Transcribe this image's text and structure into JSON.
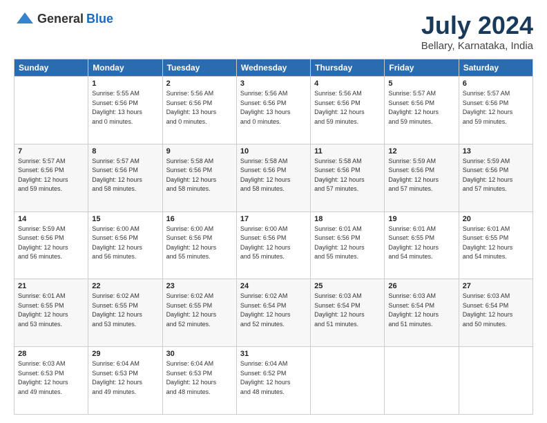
{
  "header": {
    "logo_general": "General",
    "logo_blue": "Blue",
    "month": "July 2024",
    "location": "Bellary, Karnataka, India"
  },
  "weekdays": [
    "Sunday",
    "Monday",
    "Tuesday",
    "Wednesday",
    "Thursday",
    "Friday",
    "Saturday"
  ],
  "weeks": [
    [
      {
        "day": "",
        "info": ""
      },
      {
        "day": "1",
        "info": "Sunrise: 5:55 AM\nSunset: 6:56 PM\nDaylight: 13 hours\nand 0 minutes."
      },
      {
        "day": "2",
        "info": "Sunrise: 5:56 AM\nSunset: 6:56 PM\nDaylight: 13 hours\nand 0 minutes."
      },
      {
        "day": "3",
        "info": "Sunrise: 5:56 AM\nSunset: 6:56 PM\nDaylight: 13 hours\nand 0 minutes."
      },
      {
        "day": "4",
        "info": "Sunrise: 5:56 AM\nSunset: 6:56 PM\nDaylight: 12 hours\nand 59 minutes."
      },
      {
        "day": "5",
        "info": "Sunrise: 5:57 AM\nSunset: 6:56 PM\nDaylight: 12 hours\nand 59 minutes."
      },
      {
        "day": "6",
        "info": "Sunrise: 5:57 AM\nSunset: 6:56 PM\nDaylight: 12 hours\nand 59 minutes."
      }
    ],
    [
      {
        "day": "7",
        "info": "Sunrise: 5:57 AM\nSunset: 6:56 PM\nDaylight: 12 hours\nand 59 minutes."
      },
      {
        "day": "8",
        "info": "Sunrise: 5:57 AM\nSunset: 6:56 PM\nDaylight: 12 hours\nand 58 minutes."
      },
      {
        "day": "9",
        "info": "Sunrise: 5:58 AM\nSunset: 6:56 PM\nDaylight: 12 hours\nand 58 minutes."
      },
      {
        "day": "10",
        "info": "Sunrise: 5:58 AM\nSunset: 6:56 PM\nDaylight: 12 hours\nand 58 minutes."
      },
      {
        "day": "11",
        "info": "Sunrise: 5:58 AM\nSunset: 6:56 PM\nDaylight: 12 hours\nand 57 minutes."
      },
      {
        "day": "12",
        "info": "Sunrise: 5:59 AM\nSunset: 6:56 PM\nDaylight: 12 hours\nand 57 minutes."
      },
      {
        "day": "13",
        "info": "Sunrise: 5:59 AM\nSunset: 6:56 PM\nDaylight: 12 hours\nand 57 minutes."
      }
    ],
    [
      {
        "day": "14",
        "info": "Sunrise: 5:59 AM\nSunset: 6:56 PM\nDaylight: 12 hours\nand 56 minutes."
      },
      {
        "day": "15",
        "info": "Sunrise: 6:00 AM\nSunset: 6:56 PM\nDaylight: 12 hours\nand 56 minutes."
      },
      {
        "day": "16",
        "info": "Sunrise: 6:00 AM\nSunset: 6:56 PM\nDaylight: 12 hours\nand 55 minutes."
      },
      {
        "day": "17",
        "info": "Sunrise: 6:00 AM\nSunset: 6:56 PM\nDaylight: 12 hours\nand 55 minutes."
      },
      {
        "day": "18",
        "info": "Sunrise: 6:01 AM\nSunset: 6:56 PM\nDaylight: 12 hours\nand 55 minutes."
      },
      {
        "day": "19",
        "info": "Sunrise: 6:01 AM\nSunset: 6:55 PM\nDaylight: 12 hours\nand 54 minutes."
      },
      {
        "day": "20",
        "info": "Sunrise: 6:01 AM\nSunset: 6:55 PM\nDaylight: 12 hours\nand 54 minutes."
      }
    ],
    [
      {
        "day": "21",
        "info": "Sunrise: 6:01 AM\nSunset: 6:55 PM\nDaylight: 12 hours\nand 53 minutes."
      },
      {
        "day": "22",
        "info": "Sunrise: 6:02 AM\nSunset: 6:55 PM\nDaylight: 12 hours\nand 53 minutes."
      },
      {
        "day": "23",
        "info": "Sunrise: 6:02 AM\nSunset: 6:55 PM\nDaylight: 12 hours\nand 52 minutes."
      },
      {
        "day": "24",
        "info": "Sunrise: 6:02 AM\nSunset: 6:54 PM\nDaylight: 12 hours\nand 52 minutes."
      },
      {
        "day": "25",
        "info": "Sunrise: 6:03 AM\nSunset: 6:54 PM\nDaylight: 12 hours\nand 51 minutes."
      },
      {
        "day": "26",
        "info": "Sunrise: 6:03 AM\nSunset: 6:54 PM\nDaylight: 12 hours\nand 51 minutes."
      },
      {
        "day": "27",
        "info": "Sunrise: 6:03 AM\nSunset: 6:54 PM\nDaylight: 12 hours\nand 50 minutes."
      }
    ],
    [
      {
        "day": "28",
        "info": "Sunrise: 6:03 AM\nSunset: 6:53 PM\nDaylight: 12 hours\nand 49 minutes."
      },
      {
        "day": "29",
        "info": "Sunrise: 6:04 AM\nSunset: 6:53 PM\nDaylight: 12 hours\nand 49 minutes."
      },
      {
        "day": "30",
        "info": "Sunrise: 6:04 AM\nSunset: 6:53 PM\nDaylight: 12 hours\nand 48 minutes."
      },
      {
        "day": "31",
        "info": "Sunrise: 6:04 AM\nSunset: 6:52 PM\nDaylight: 12 hours\nand 48 minutes."
      },
      {
        "day": "",
        "info": ""
      },
      {
        "day": "",
        "info": ""
      },
      {
        "day": "",
        "info": ""
      }
    ]
  ]
}
